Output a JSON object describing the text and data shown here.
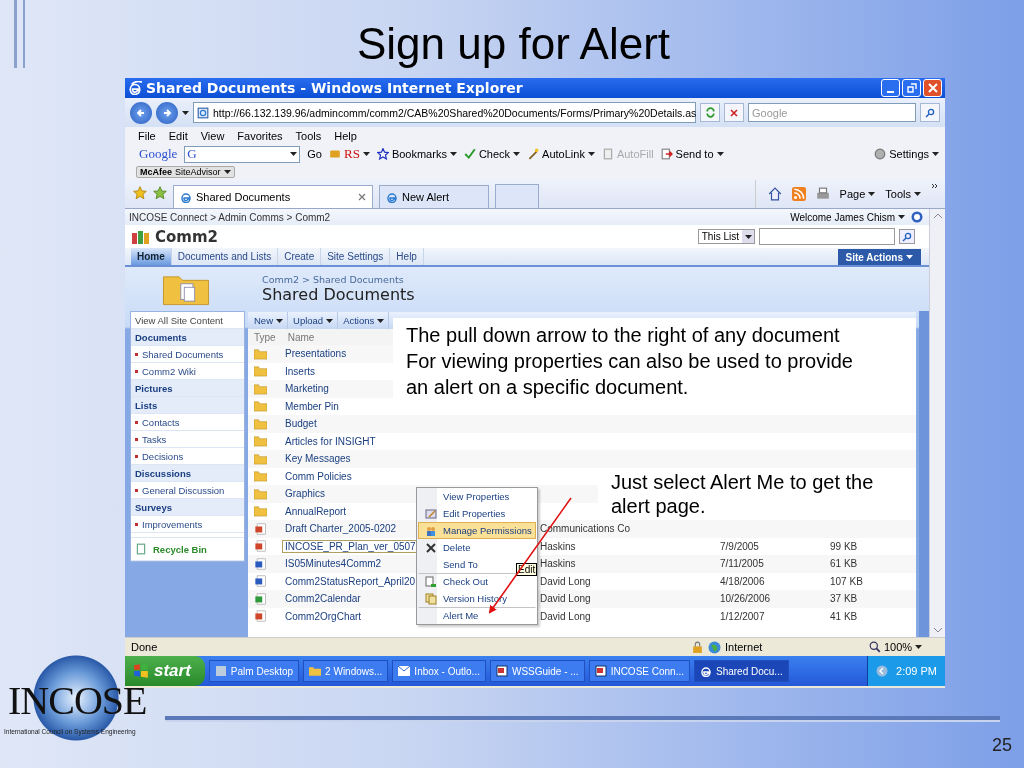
{
  "slide": {
    "title": "Sign up for Alert",
    "page_number": "25",
    "logo": {
      "name": "INCOSE",
      "tagline": "International Council on Systems Engineering"
    }
  },
  "browser": {
    "title": "Shared Documents - Windows Internet Explorer",
    "address": "http://66.132.139.96/admincomm/comm2/CAB%20Shared%20Documents/Forms/Primary%20Details.as",
    "search_placeholder": "Google",
    "menu": [
      "File",
      "Edit",
      "View",
      "Favorites",
      "Tools",
      "Help"
    ],
    "google_logo": "Google",
    "google_field": "G",
    "google_items": [
      {
        "label": "Go",
        "kind": "text",
        "dropdown": false,
        "disabled": false
      },
      {
        "label": "RS",
        "kind": "logo",
        "dropdown": true,
        "disabled": false
      },
      {
        "label": "Bookmarks",
        "kind": "text",
        "dropdown": true,
        "disabled": false
      },
      {
        "label": "Check",
        "kind": "text",
        "dropdown": true,
        "disabled": false
      },
      {
        "label": "AutoLink",
        "kind": "text",
        "dropdown": true,
        "disabled": false
      },
      {
        "label": "AutoFill",
        "kind": "text",
        "dropdown": false,
        "disabled": true
      },
      {
        "label": "Send to",
        "kind": "text",
        "dropdown": true,
        "disabled": false
      },
      {
        "label": "Settings",
        "kind": "text",
        "dropdown": true,
        "disabled": false
      }
    ],
    "siteadvisor": "**McAfee** SiteAdvisor",
    "tabs": [
      {
        "label": "Shared Documents",
        "selected": true
      },
      {
        "label": "New Alert",
        "selected": false
      }
    ],
    "commands": [
      "Page",
      "Tools"
    ],
    "status": "Done",
    "zone": "Internet",
    "zoom": "100%"
  },
  "sharepoint": {
    "breadcrumb": "INCOSE Connect > Admin Comms > Comm2",
    "welcome": "Welcome James Chism",
    "site_title": "Comm2",
    "scope": "This List",
    "tabs": [
      {
        "label": "Home",
        "selected": true
      },
      {
        "label": "Documents and Lists",
        "selected": false
      },
      {
        "label": "Create",
        "selected": false
      },
      {
        "label": "Site Settings",
        "selected": false
      },
      {
        "label": "Help",
        "selected": false
      }
    ],
    "site_actions": "Site Actions",
    "page_breadcrumb": "Comm2 > Shared Documents",
    "page_title": "Shared Documents",
    "view_all": "View All Site Content",
    "nav": [
      {
        "heading": "Documents",
        "items": [
          "Shared Documents",
          "Comm2 Wiki"
        ]
      },
      {
        "heading": "Pictures"
      },
      {
        "heading": "Lists",
        "items": [
          "Contacts",
          "Tasks",
          "Decisions"
        ]
      },
      {
        "heading": "Discussions",
        "items": [
          "General Discussion"
        ]
      },
      {
        "heading": "Surveys",
        "items": [
          "Improvements"
        ]
      }
    ],
    "recycle_bin": "Recycle Bin",
    "toolbar": [
      "New",
      "Upload",
      "Actions"
    ],
    "columns": [
      "Type",
      "Name"
    ],
    "rows": [
      {
        "kind": "folder",
        "name": "Presentations",
        "selected": false
      },
      {
        "kind": "folder",
        "name": "Inserts",
        "selected": false
      },
      {
        "kind": "folder",
        "name": "Marketing",
        "selected": false
      },
      {
        "kind": "folder",
        "name": "Member Pin",
        "selected": false
      },
      {
        "kind": "folder",
        "name": "Budget",
        "selected": false
      },
      {
        "kind": "folder",
        "name": "Articles for INSIGHT",
        "selected": false
      },
      {
        "kind": "folder",
        "name": "Key Messages",
        "selected": false
      },
      {
        "kind": "folder",
        "name": "Comm Policies",
        "selected": false
      },
      {
        "kind": "folder",
        "name": "Graphics",
        "selected": false
      },
      {
        "kind": "folder",
        "name": "AnnualReport",
        "selected": false
      },
      {
        "kind": "presentation",
        "name": "Draft Charter_2005-0202",
        "selected": false,
        "modified_by": "Communications Co"
      },
      {
        "kind": "presentation",
        "name": "INCOSE_PR_Plan_ver_0507",
        "selected": true,
        "modified_by": "Haskins",
        "modified": "7/9/2005",
        "size": "99 KB"
      },
      {
        "kind": "word",
        "name": "IS05Minutes4Comm2",
        "selected": false,
        "modified_by": "Haskins",
        "modified": "7/11/2005",
        "size": "61 KB"
      },
      {
        "kind": "word",
        "name": "Comm2StatusReport_April20",
        "selected": false,
        "modified_by": "David Long",
        "modified": "4/18/2006",
        "size": "107 KB"
      },
      {
        "kind": "excel",
        "name": "Comm2Calendar",
        "selected": false,
        "modified_by": "David Long",
        "modified": "10/26/2006",
        "size": "37 KB"
      },
      {
        "kind": "presentation",
        "name": "Comm2OrgChart",
        "selected": false,
        "modified_by": "David Long",
        "modified": "1/12/2007",
        "size": "41 KB"
      }
    ],
    "menu": [
      {
        "label": "View Properties",
        "selected": false,
        "separator_before": false
      },
      {
        "label": "Edit Properties",
        "selected": false,
        "separator_before": false
      },
      {
        "label": "Manage Permissions",
        "selected": true,
        "separator_before": false
      },
      {
        "label": "Delete",
        "selected": false,
        "separator_before": false
      },
      {
        "label": "Send To",
        "selected": false,
        "separator_before": false
      },
      {
        "label": "Check Out",
        "selected": false,
        "separator_before": true
      },
      {
        "label": "Version History",
        "selected": false,
        "separator_before": false
      },
      {
        "label": "Alert Me",
        "selected": false,
        "separator_before": true
      }
    ],
    "tooltip": "Edit"
  },
  "callouts": [
    "The pull down arrow to the right of any document\nFor viewing properties can also be used to provide\nan alert on a specific document.",
    "Just select Alert Me to get the\nalert page."
  ],
  "taskbar": {
    "start": "start",
    "tasks": [
      {
        "label": "Palm Desktop",
        "selected": false
      },
      {
        "label": "2 Windows...",
        "selected": false
      },
      {
        "label": "Inbox - Outlo...",
        "selected": false
      },
      {
        "label": "WSSGuide - ...",
        "selected": false
      },
      {
        "label": "INCOSE Conn...",
        "selected": false
      },
      {
        "label": "Shared Docu...",
        "selected": true
      }
    ],
    "clock": "2:09 PM"
  }
}
